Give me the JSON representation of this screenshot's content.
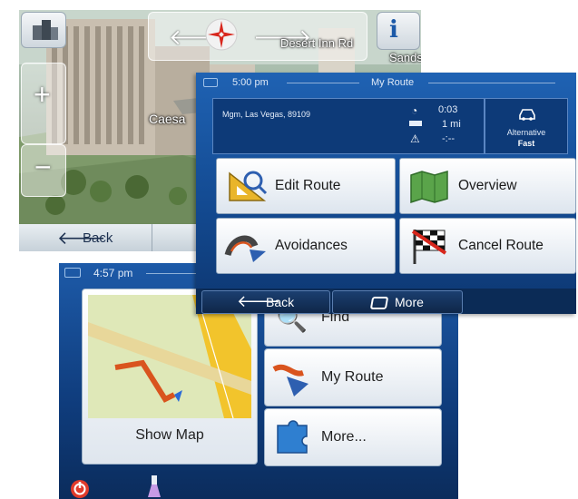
{
  "map_screen": {
    "street_label": "Desert Inn Rd",
    "poi_label": "Sands",
    "building_label": "Caesa",
    "zoom_in": "+",
    "zoom_out": "−",
    "back_label": "Back"
  },
  "menu_screen": {
    "status_time": "4:57 pm",
    "show_map_label": "Show Map",
    "find_label": "Find",
    "my_route_label": "My Route",
    "more_label": "More..."
  },
  "route_screen": {
    "status_time": "5:00 pm",
    "title": "My Route",
    "address": "Mgm, Las Vegas, 89109",
    "eta_time": "0:03",
    "distance": "1 mi",
    "delay": "-:--",
    "route_type_label": "Alternative",
    "route_type_value": "Fast",
    "buttons": {
      "edit_route": "Edit Route",
      "overview": "Overview",
      "avoidances": "Avoidances",
      "cancel_route": "Cancel Route"
    },
    "back_label": "Back",
    "more_label": "More"
  },
  "colors": {
    "accent_blue": "#134a91",
    "panel_blue": "#0d3a78",
    "route_orange": "#d9541e",
    "map_yellow": "#f2c42c"
  }
}
